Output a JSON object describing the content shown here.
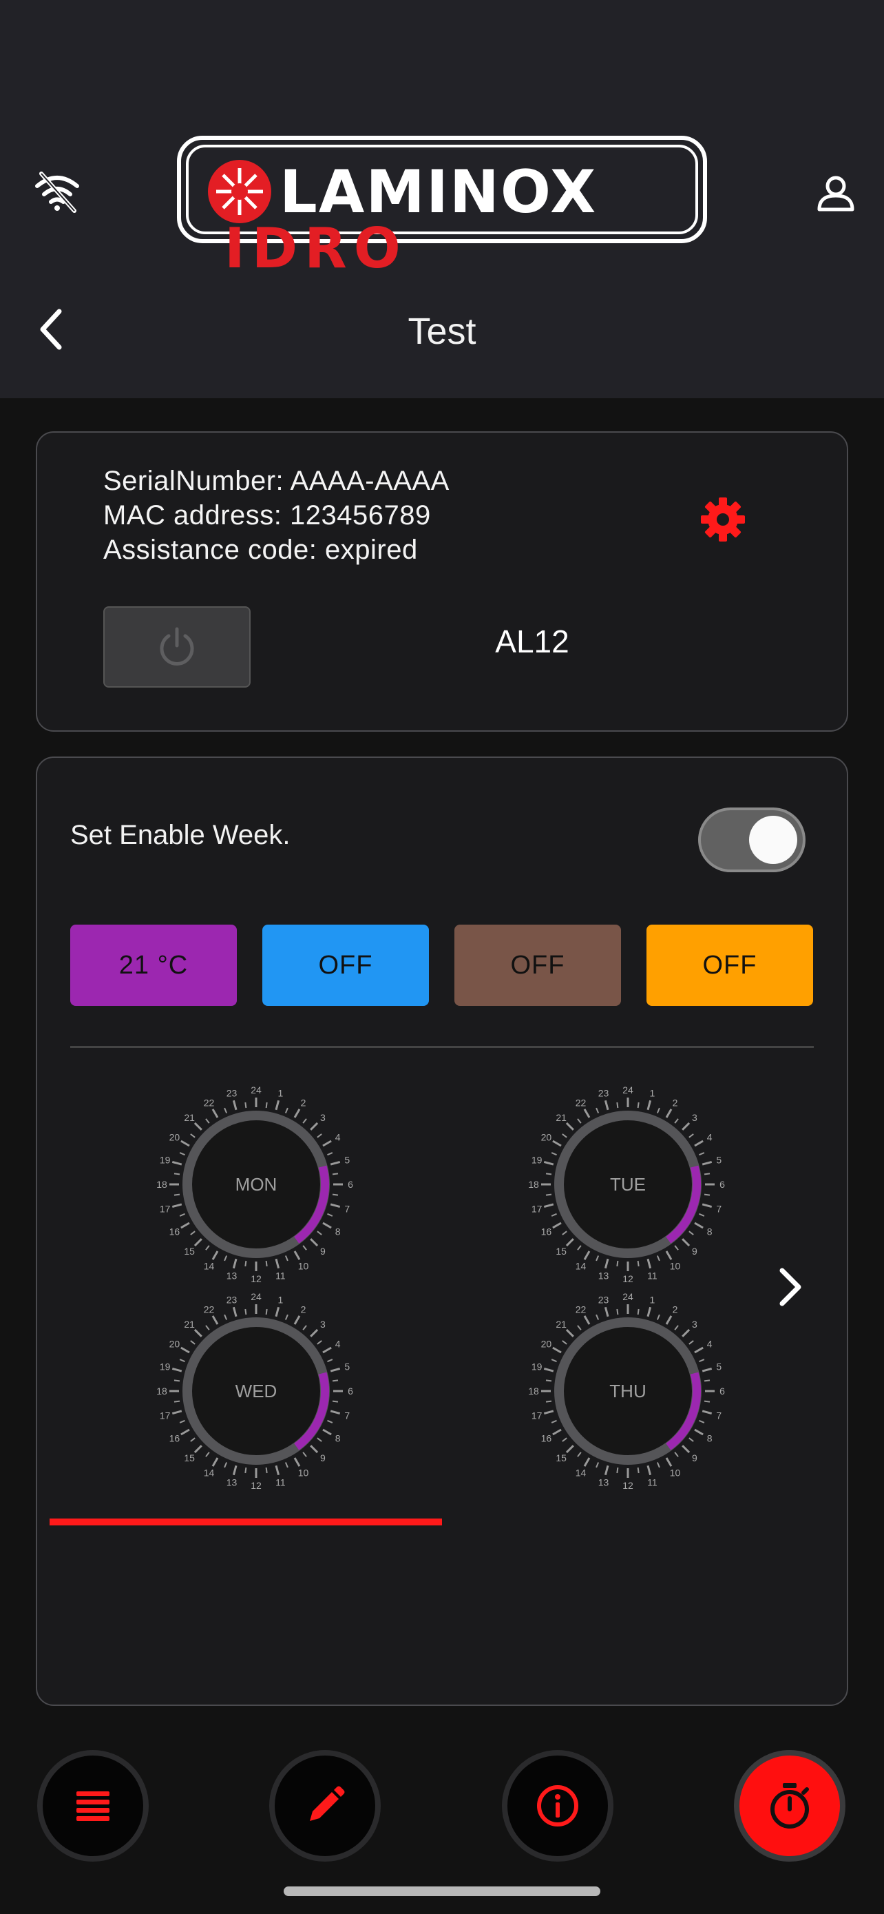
{
  "header": {
    "title": "Test",
    "logo_top": "LAMINOX",
    "logo_bottom": "IDRO"
  },
  "device": {
    "serial_line": "SerialNumber: AAAA-AAAA",
    "mac_line": "MAC address: 123456789",
    "assistance_line": "Assistance code: expired",
    "model": "AL12"
  },
  "week": {
    "enable_label": "Set Enable Week.",
    "enabled": true,
    "modes": [
      {
        "label": "21 °C",
        "color": "#9c27b0"
      },
      {
        "label": "OFF",
        "color": "#2196f3"
      },
      {
        "label": "OFF",
        "color": "#795548"
      },
      {
        "label": "OFF",
        "color": "#ffa000"
      }
    ],
    "days": [
      {
        "label": "MON"
      },
      {
        "label": "TUE"
      },
      {
        "label": "WED"
      },
      {
        "label": "THU"
      }
    ],
    "hour_labels": [
      "24",
      "1",
      "2",
      "3",
      "4",
      "5",
      "6",
      "7",
      "8",
      "9",
      "10",
      "11",
      "12",
      "13",
      "14",
      "15",
      "16",
      "17",
      "18",
      "19",
      "20",
      "21",
      "22",
      "23"
    ],
    "active_arc_color": "#9c27b0",
    "page_indicator_color": "#ff1a1a"
  },
  "nav": {
    "items": [
      {
        "icon": "list-icon",
        "active": false
      },
      {
        "icon": "pencil-icon",
        "active": false
      },
      {
        "icon": "info-icon",
        "active": false
      },
      {
        "icon": "stopwatch-icon",
        "active": true
      }
    ]
  },
  "colors": {
    "accent": "#ff1a1a",
    "header_bg": "#222227",
    "page_bg": "#121212"
  }
}
